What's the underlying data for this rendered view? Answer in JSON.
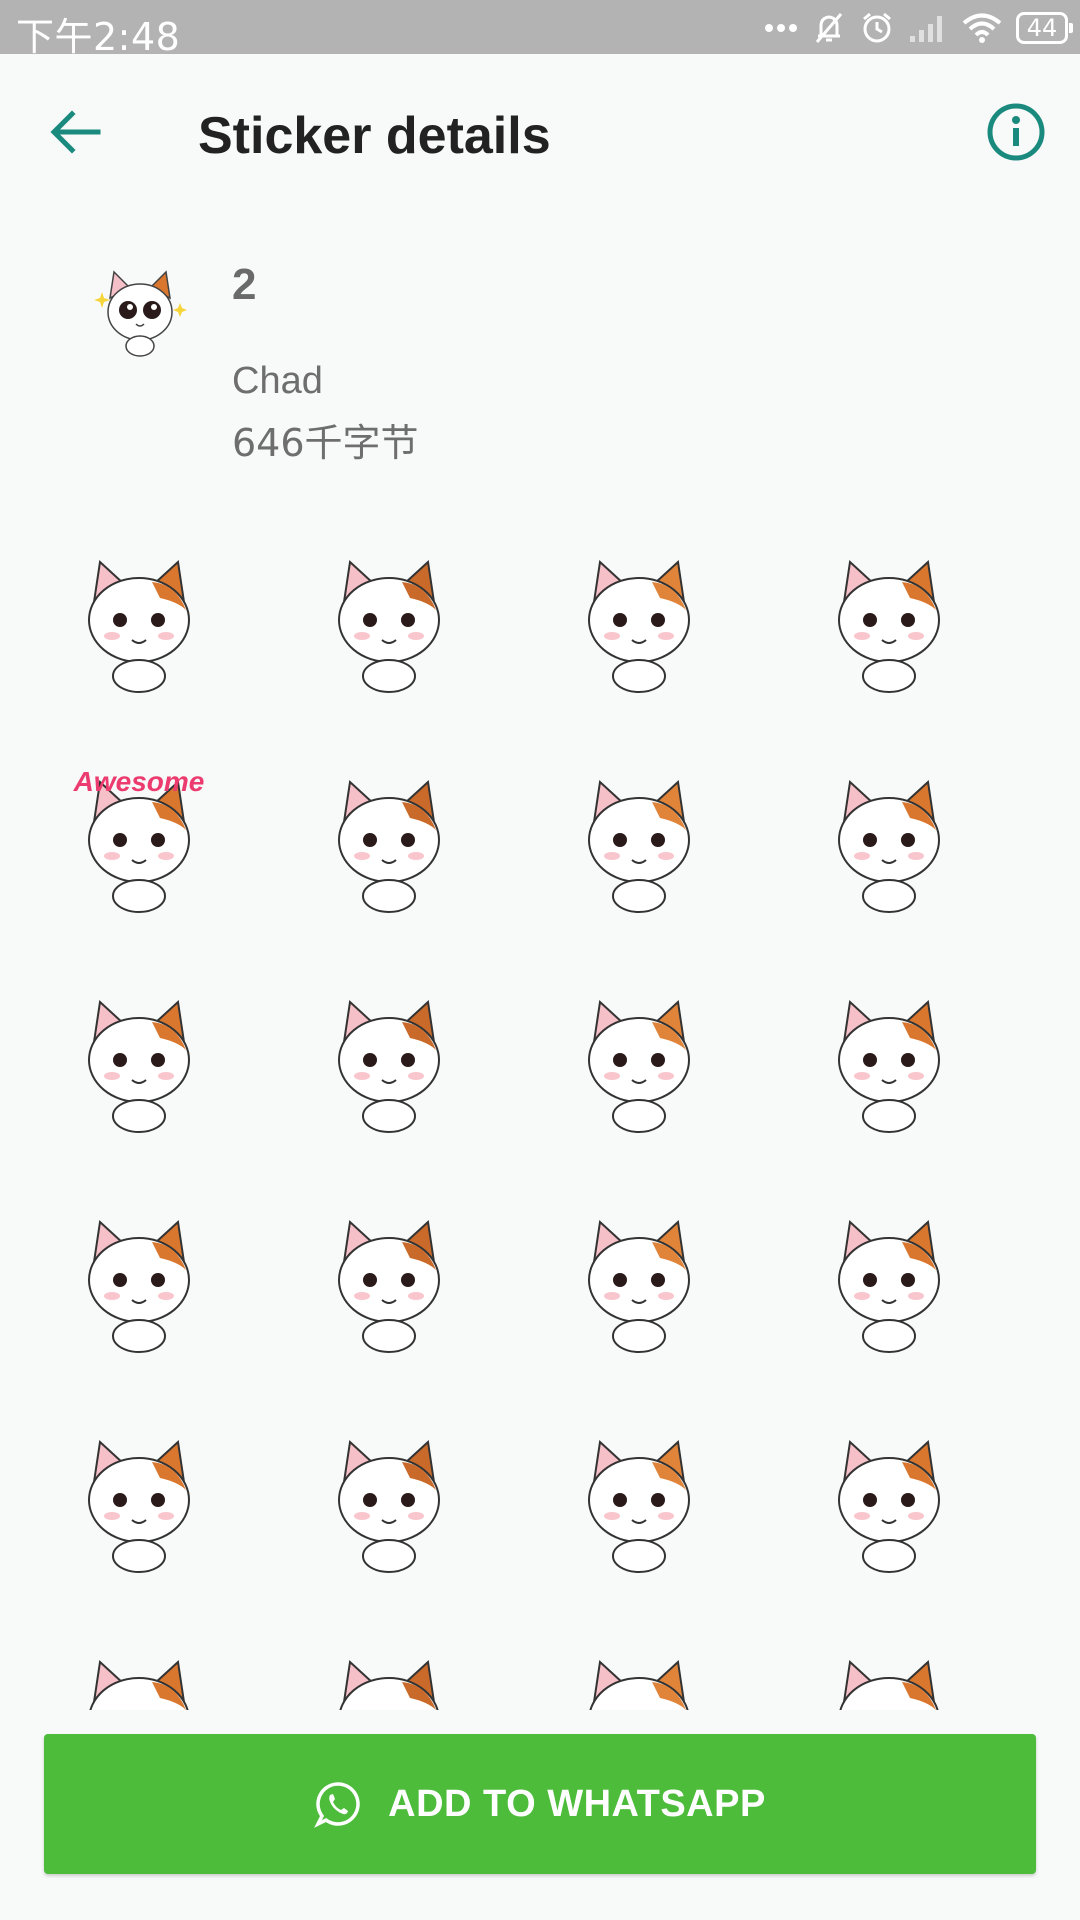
{
  "status_bar": {
    "time": "下午2:48",
    "battery": "44",
    "icons": [
      "more-dots-icon",
      "bell-off-icon",
      "alarm-icon",
      "signal-icon",
      "wifi-icon",
      "battery-icon"
    ]
  },
  "toolbar": {
    "title": "Sticker details",
    "back_icon": "arrow-left-icon",
    "info_icon": "info-icon"
  },
  "pack": {
    "name": "2",
    "publisher": "Chad",
    "size": "646千字节"
  },
  "stickers": [
    {
      "label": ""
    },
    {
      "label": ""
    },
    {
      "label": ""
    },
    {
      "label": ""
    },
    {
      "label": "Awesome"
    },
    {
      "label": ""
    },
    {
      "label": ""
    },
    {
      "label": ""
    },
    {
      "label": ""
    },
    {
      "label": ""
    },
    {
      "label": ""
    },
    {
      "label": ""
    },
    {
      "label": ""
    },
    {
      "label": ""
    },
    {
      "label": ""
    },
    {
      "label": ""
    },
    {
      "label": ""
    },
    {
      "label": ""
    },
    {
      "label": ""
    },
    {
      "label": ""
    },
    {
      "label": ""
    },
    {
      "label": ""
    },
    {
      "label": ""
    },
    {
      "label": ""
    }
  ],
  "button": {
    "label": "ADD TO WHATSAPP",
    "icon": "whatsapp-icon"
  },
  "colors": {
    "accent": "#1a8a7e",
    "button": "#4cbc3a",
    "status_bar": "#b3b3b3"
  }
}
